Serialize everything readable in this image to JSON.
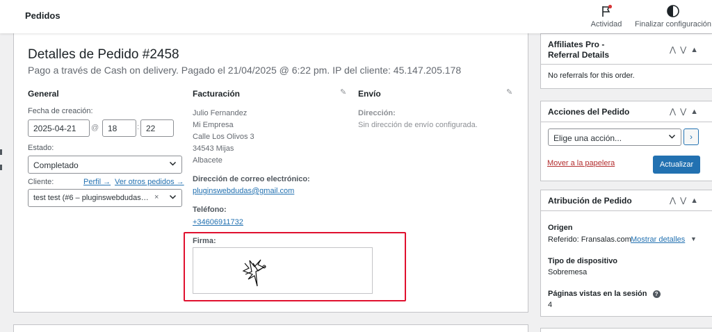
{
  "topbar": {
    "title": "Pedidos",
    "activity_label": "Actividad",
    "finish_label": "Finalizar configuración",
    "activity_icon": "flag-icon",
    "finish_icon": "half-circle-icon"
  },
  "order": {
    "heading": "Detalles de Pedido #2458",
    "subheading": "Pago a través de Cash on delivery. Pagado el 21/04/2025 @ 6:22 pm. IP del cliente: 45.147.205.178"
  },
  "general": {
    "heading": "General",
    "created_label": "Fecha de creación:",
    "date": "2025-04-21",
    "at": "@",
    "hour": "18",
    "colon": ":",
    "minute": "22",
    "status_label": "Estado:",
    "status_value": "Completado",
    "customer_label": "Cliente:",
    "profile_link": "Perfil →",
    "other_orders_link": "Ver otros pedidos →",
    "customer_value": "test test (#6 – pluginswebdudas…",
    "clear": "×"
  },
  "billing": {
    "heading": "Facturación",
    "lines": [
      "Julio Fernandez",
      "Mi Empresa",
      "Calle Los Olivos 3",
      "34543 Mijas",
      "Albacete"
    ],
    "email_label": "Dirección de correo electrónico:",
    "email": "pluginswebdudas@gmail.com",
    "phone_label": "Teléfono:",
    "phone": "+34606911732",
    "signature_label": "Firma:"
  },
  "shipping": {
    "heading": "Envío",
    "address_label": "Dirección:",
    "address_value": "Sin dirección de envío configurada."
  },
  "affiliates": {
    "title_line1": "Affiliates Pro -",
    "title_line2": "Referral Details",
    "body": "No referrals for this order."
  },
  "actions": {
    "title": "Acciones del Pedido",
    "select_placeholder": "Elige una acción...",
    "go": "›",
    "trash": "Mover a la papelera",
    "update": "Actualizar"
  },
  "attribution": {
    "title": "Atribución de Pedido",
    "origin_label": "Origen",
    "origin_value": "Referido: Fransalas.com",
    "show_details": "Mostrar detalles",
    "device_label": "Tipo de dispositivo",
    "device_value": "Sobremesa",
    "pages_label": "Páginas vistas en la sesión",
    "pages_value": "4",
    "help_mark": "?"
  },
  "controls": {
    "up": "⋀",
    "down": "⋁",
    "toggle": "▲",
    "triangle_down": "▼",
    "chevron": "⌄",
    "pencil": "✎"
  },
  "colors": {
    "accent": "#2271b1",
    "highlight_border": "#e0102e",
    "danger": "#b32d2e"
  }
}
